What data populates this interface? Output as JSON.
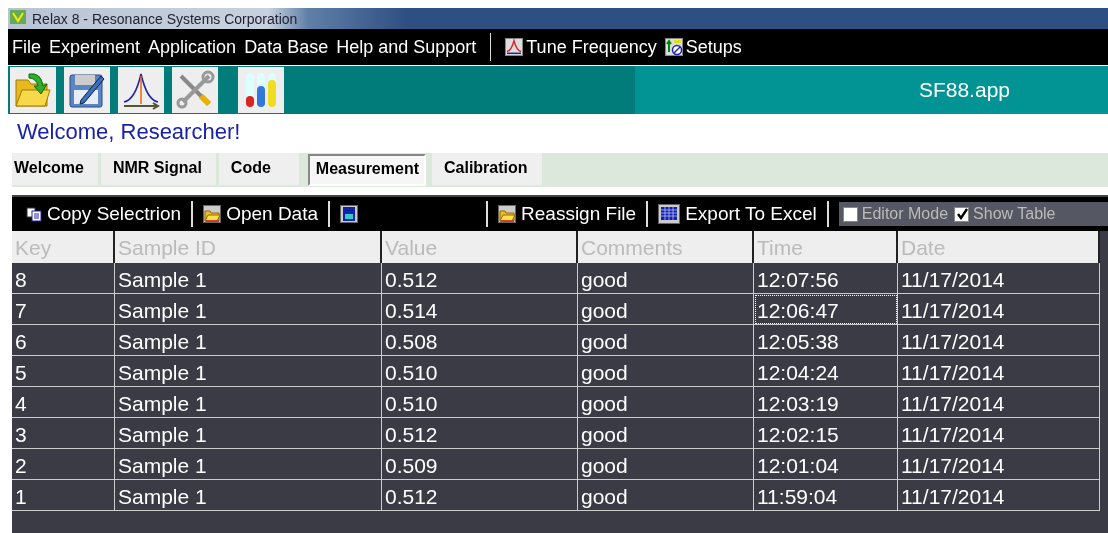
{
  "window": {
    "title": "Relax 8 - Resonance Systems Corporation"
  },
  "menu": [
    {
      "label": "File"
    },
    {
      "label": "Experiment"
    },
    {
      "label": "Application"
    },
    {
      "label": "Data Base"
    },
    {
      "label": "Help and Support"
    }
  ],
  "menu_tools": [
    {
      "label": "Tune Frequency"
    },
    {
      "label": "Setups"
    }
  ],
  "toolbar": {
    "file_name": "SF88.app"
  },
  "welcome": "Welcome, Researcher!",
  "tabs": [
    {
      "label": "Welcome",
      "selected": false
    },
    {
      "label": "NMR Signal",
      "selected": false
    },
    {
      "label": "Code",
      "selected": false
    },
    {
      "label": "Measurement",
      "selected": true
    },
    {
      "label": "Calibration",
      "selected": false
    }
  ],
  "actions": [
    {
      "label": "Copy Selectrion"
    },
    {
      "label": "Open Data"
    },
    {
      "label": "Reassign File"
    },
    {
      "label": "Export To Excel"
    }
  ],
  "options": [
    {
      "label": "Editor Mode",
      "checked": false
    },
    {
      "label": "Show Table",
      "checked": true
    }
  ],
  "table": {
    "columns": [
      "Key",
      "Sample ID",
      "Value",
      "Comments",
      "Time",
      "Date"
    ],
    "rows": [
      {
        "cells": [
          "8",
          "Sample 1",
          "0.512",
          "good",
          "12:07:56",
          "11/17/2014"
        ],
        "time_focused": false
      },
      {
        "cells": [
          "7",
          "Sample 1",
          "0.514",
          "good",
          "12:06:47",
          "11/17/2014"
        ],
        "time_focused": true
      },
      {
        "cells": [
          "6",
          "Sample 1",
          "0.508",
          "good",
          "12:05:38",
          "11/17/2014"
        ],
        "time_focused": false
      },
      {
        "cells": [
          "5",
          "Sample 1",
          "0.510",
          "good",
          "12:04:24",
          "11/17/2014"
        ],
        "time_focused": false
      },
      {
        "cells": [
          "4",
          "Sample 1",
          "0.510",
          "good",
          "12:03:19",
          "11/17/2014"
        ],
        "time_focused": false
      },
      {
        "cells": [
          "3",
          "Sample 1",
          "0.512",
          "good",
          "12:02:15",
          "11/17/2014"
        ],
        "time_focused": false
      },
      {
        "cells": [
          "2",
          "Sample 1",
          "0.509",
          "good",
          "12:01:04",
          "11/17/2014"
        ],
        "time_focused": false
      },
      {
        "cells": [
          "1",
          "Sample 1",
          "0.512",
          "good",
          "11:59:04",
          "11/17/2014"
        ],
        "time_focused": false
      }
    ]
  }
}
